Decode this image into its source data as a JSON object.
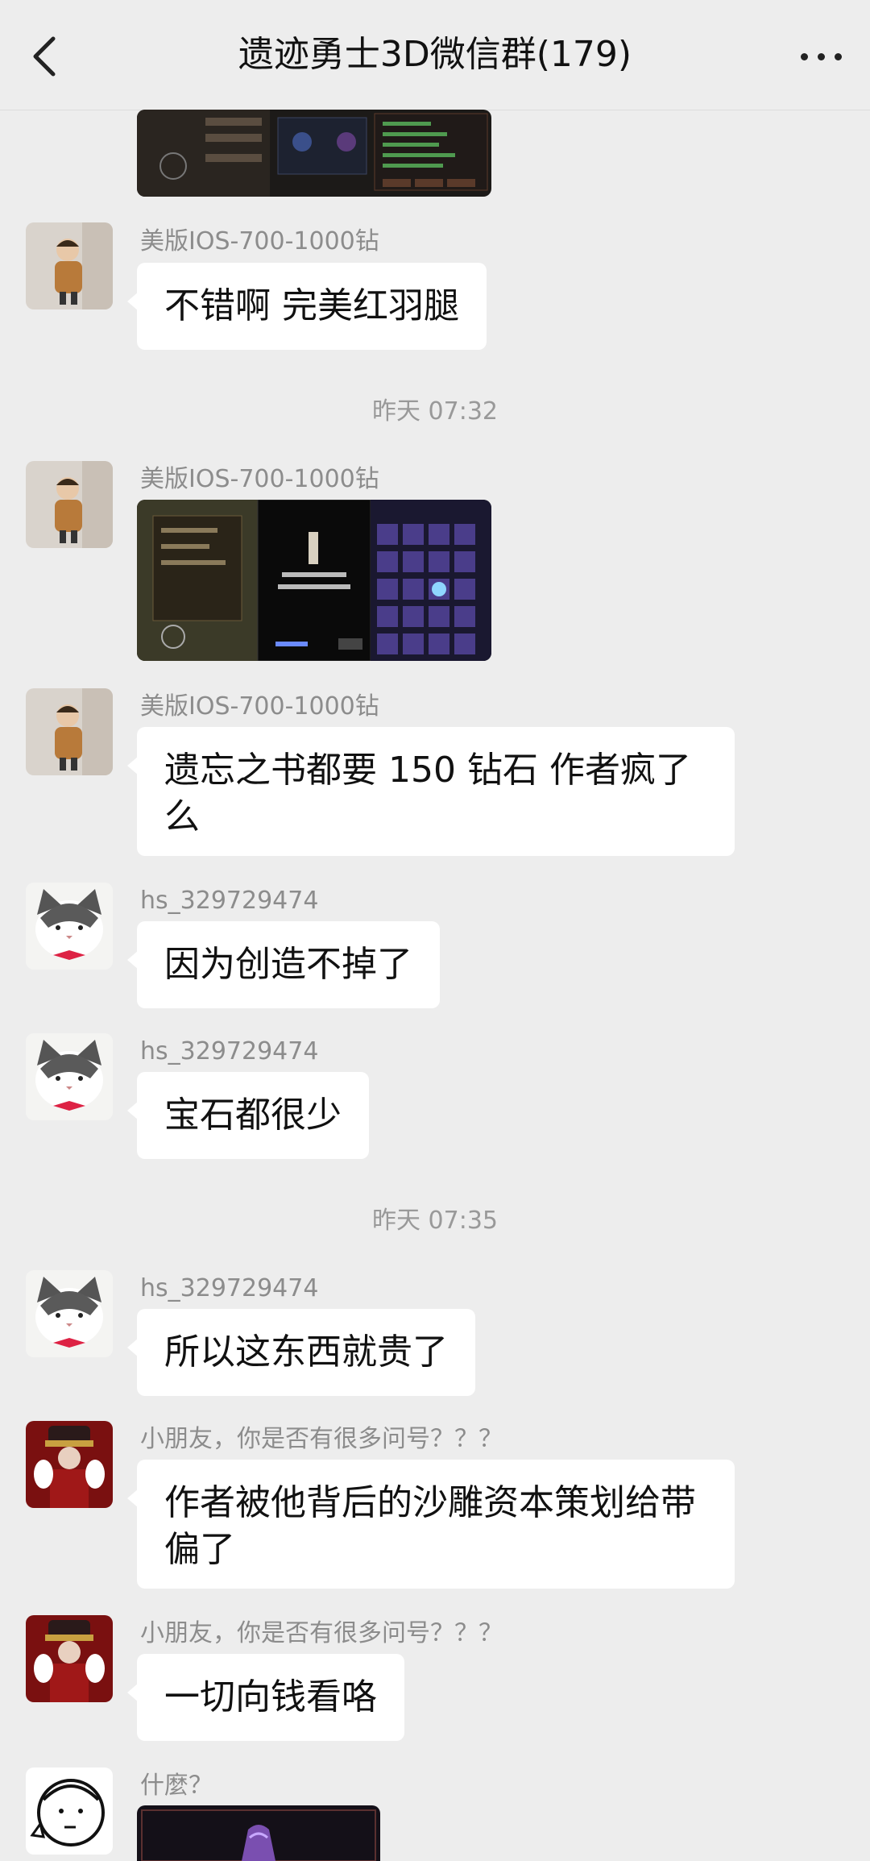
{
  "header": {
    "title": "遗迹勇士3D微信群(179)",
    "back_icon": "chevron-left-icon",
    "more_icon": "more-dots-icon"
  },
  "messages": [
    {
      "sender": "美版IOS-700-1000钻",
      "text": "不错啊  完美红羽腿"
    },
    {
      "time": "昨天  07:32"
    },
    {
      "sender": "美版IOS-700-1000钻",
      "image": "game-screenshot"
    },
    {
      "sender": "美版IOS-700-1000钻",
      "text_line1": "遗忘之书都要 150 钻石  作者疯了",
      "text_line2": "么"
    },
    {
      "sender": "hs_329729474",
      "text": "因为创造不掉了"
    },
    {
      "sender": "hs_329729474",
      "text": "宝石都很少"
    },
    {
      "time": "昨天  07:35"
    },
    {
      "sender": "hs_329729474",
      "text": "所以这东西就贵了"
    },
    {
      "sender": "小朋友，你是否有很多问号？？？",
      "text_line1": "作者被他背后的沙雕资本策划给带",
      "text_line2": "偏了"
    },
    {
      "sender": "小朋友，你是否有很多问号？？？",
      "text": "一切向钱看咯"
    },
    {
      "sender": "什麼？",
      "image": "game-screenshot"
    }
  ],
  "colors": {
    "background": "#ededed",
    "bubble": "#ffffff",
    "name_text": "#8c8c8c",
    "time_text": "#999999"
  }
}
